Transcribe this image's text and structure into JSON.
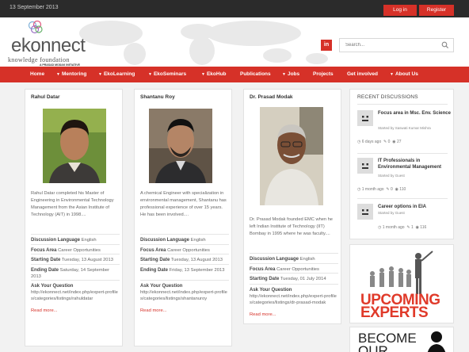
{
  "topbar": {
    "date": "13 September 2013",
    "login": "Log in",
    "register": "Register"
  },
  "logo": {
    "brand": "ekonnect",
    "tagline": "knowledge foundation",
    "sub": "A PRASAD MODAK INITIATIVE"
  },
  "header": {
    "linkedin": "in",
    "search_placeholder": "Search..."
  },
  "nav": [
    {
      "label": "Home",
      "dropdown": false
    },
    {
      "label": "Mentoring",
      "dropdown": true
    },
    {
      "label": "EkoLearning",
      "dropdown": true
    },
    {
      "label": "EkoSeminars",
      "dropdown": true
    },
    {
      "label": "EkoHub",
      "dropdown": true
    },
    {
      "label": "Publications",
      "dropdown": false
    },
    {
      "label": "Jobs",
      "dropdown": true
    },
    {
      "label": "Projects",
      "dropdown": false
    },
    {
      "label": "Get involved",
      "dropdown": false
    },
    {
      "label": "About Us",
      "dropdown": true
    }
  ],
  "field_labels": {
    "language": "Discussion Language",
    "focus": "Focus Area",
    "start": "Starting Date",
    "end": "Ending Date",
    "ask": "Ask Your Question",
    "readmore": "Read more..."
  },
  "experts": [
    {
      "name": "Rahul Datar",
      "bio": "Rahul Datar completed his Master of Engineering in Environmental Technology Management from the Asian Institute of Technology (AIT) in 1998....",
      "language": "English",
      "focus": "Career Opportunities",
      "start": "Tuesday, 13 August 2013",
      "end": "Saturday, 14 September 2013",
      "link": "http://ekonnect.net/index.php/expert-profiles/categories/listings/rahuldatar"
    },
    {
      "name": "Shantanu Roy",
      "bio": "A chemical Engineer with specialization in environmental management, Shantanu has professional experience of over 15 years. He has been involved....",
      "language": "English",
      "focus": "Career Opportunities",
      "start": "Tuesday, 13 August 2013",
      "end": "Friday, 13 September 2013",
      "link": "http://ekonnect.net/index.php/expert-profiles/categories/listings/shantanuroy"
    },
    {
      "name": "Dr. Prasad Modak",
      "bio": "Dr. Prasad Modak founded EMC when he left Indian Institute of Technology (IIT) Bombay in 1995 where he was faculty....",
      "language": "English",
      "focus": "Career Opportunities",
      "start": "Tuesday, 01 July 2014",
      "link": "http://ekonnect.net/index.php/expert-profiles/categories/listings/dr-prasad-modak"
    }
  ],
  "sidebar": {
    "title": "RECENT DISCUSSIONS",
    "discussions": [
      {
        "title": "Focus area in Msc. Env. Science",
        "by": "Started by Saswati Kumar Mishra",
        "time": "6 days ago",
        "replies": "0",
        "views": "27"
      },
      {
        "title": "IT Professionals in Environmental Management",
        "by": "Started by Guest",
        "time": "1 month ago",
        "replies": "0",
        "views": "110"
      },
      {
        "title": "Career options in EIA",
        "by": "Started by Guest",
        "time": "1 month ago",
        "replies": "1",
        "views": "116"
      }
    ]
  },
  "promos": {
    "upcoming": [
      "UPCOMING",
      "EXPERTS"
    ],
    "become": [
      "BECOME",
      "OUR"
    ]
  },
  "colors": {
    "accent": "#d63128",
    "topbar": "#2b2b2b"
  }
}
